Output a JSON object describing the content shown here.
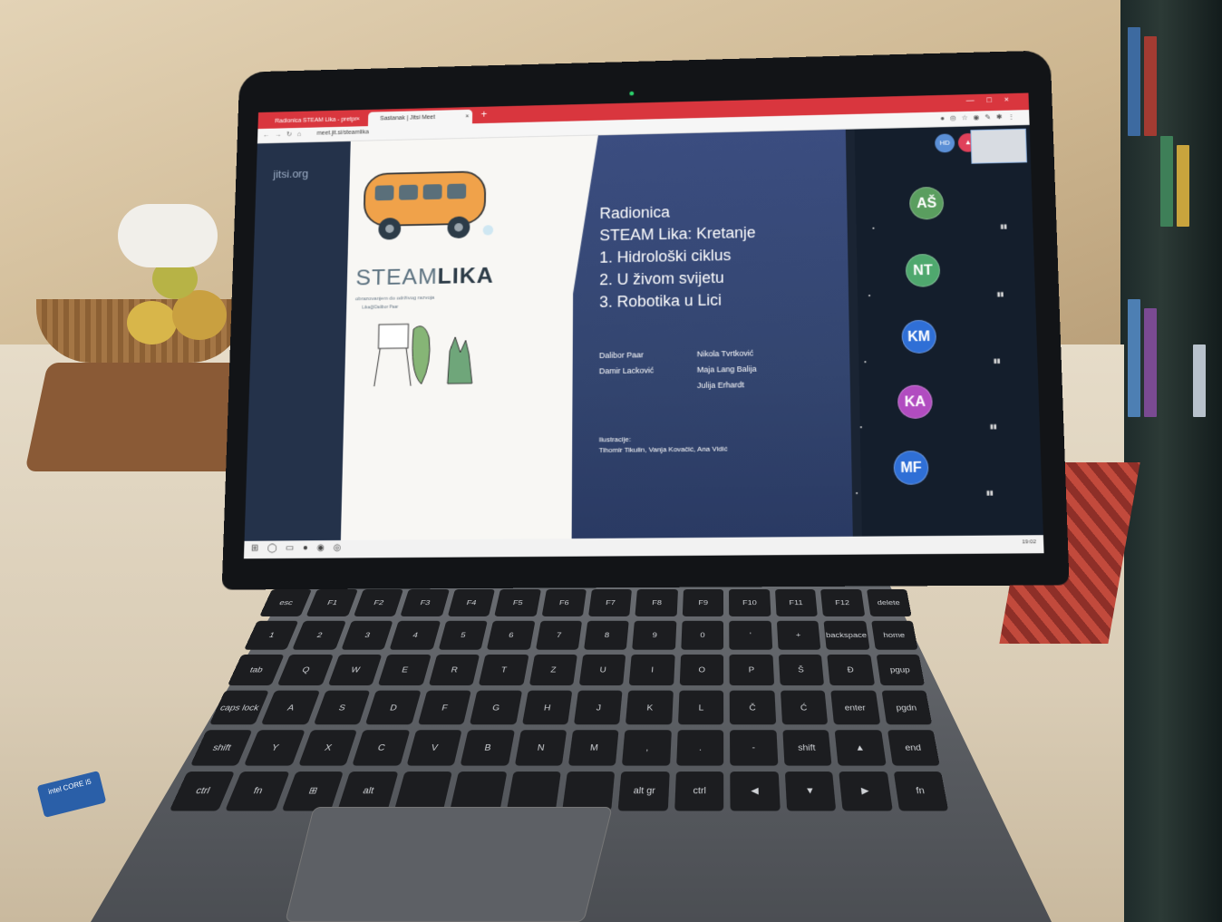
{
  "browser": {
    "tabs": [
      {
        "label": "Radionica STEAM Lika - pretpr"
      },
      {
        "label": "Sastanak | Jitsi Meet"
      }
    ],
    "url": "meet.jit.si/steamlika"
  },
  "jitsi": {
    "logo": "jitsi.org"
  },
  "slide": {
    "logo_light": "STEAM",
    "logo_bold": "LIKA",
    "tagline": "obrazovanjem do održivog razvoja",
    "subtagline": "Lika@Dalibor Paar",
    "title_lines": [
      "Radionica",
      "STEAM Lika: Kretanje",
      "1. Hidrološki ciklus",
      "2. U živom svijetu",
      "3. Robotika u Lici"
    ],
    "authors_left": [
      "Dalibor Paar",
      "Damir Lacković"
    ],
    "authors_right": [
      "Nikola Tvrtković",
      "Maja Lang Balija",
      "Julija Erhardt"
    ],
    "illustrations_label": "Ilustracije:",
    "illustrations_names": "Tihomir Tikulin, Vanja Kovačić, Ana Vidić"
  },
  "filmstrip": {
    "quality_badge": "HD",
    "participants": [
      {
        "initials": "AŠ",
        "color": "#5a9e5f"
      },
      {
        "initials": "NT",
        "color": "#4fa86e"
      },
      {
        "initials": "KM",
        "color": "#2f6fd6"
      },
      {
        "initials": "KA",
        "color": "#b14cc0"
      },
      {
        "initials": "MF",
        "color": "#2f6fd6"
      }
    ]
  },
  "taskbar": {
    "clock": "19:02"
  },
  "keyboard": {
    "keys": [
      "esc",
      "F1",
      "F2",
      "F3",
      "F4",
      "F5",
      "F6",
      "F7",
      "F8",
      "F9",
      "F10",
      "F11",
      "F12",
      "delete",
      "1",
      "2",
      "3",
      "4",
      "5",
      "6",
      "7",
      "8",
      "9",
      "0",
      "'",
      "+",
      "backspace",
      "home",
      "tab",
      "Q",
      "W",
      "E",
      "R",
      "T",
      "Z",
      "U",
      "I",
      "O",
      "P",
      "Š",
      "Đ",
      "pgup",
      "caps lock",
      "A",
      "S",
      "D",
      "F",
      "G",
      "H",
      "J",
      "K",
      "L",
      "Č",
      "Ć",
      "enter",
      "pgdn",
      "shift",
      "Y",
      "X",
      "C",
      "V",
      "B",
      "N",
      "M",
      ",",
      ".",
      "-",
      "shift",
      "▲",
      "end",
      "ctrl",
      "fn",
      "⊞",
      "alt",
      "",
      "",
      "",
      "",
      "alt gr",
      "ctrl",
      "◀",
      "▼",
      "▶",
      "fn"
    ],
    "sticker": "intel CORE i5"
  }
}
